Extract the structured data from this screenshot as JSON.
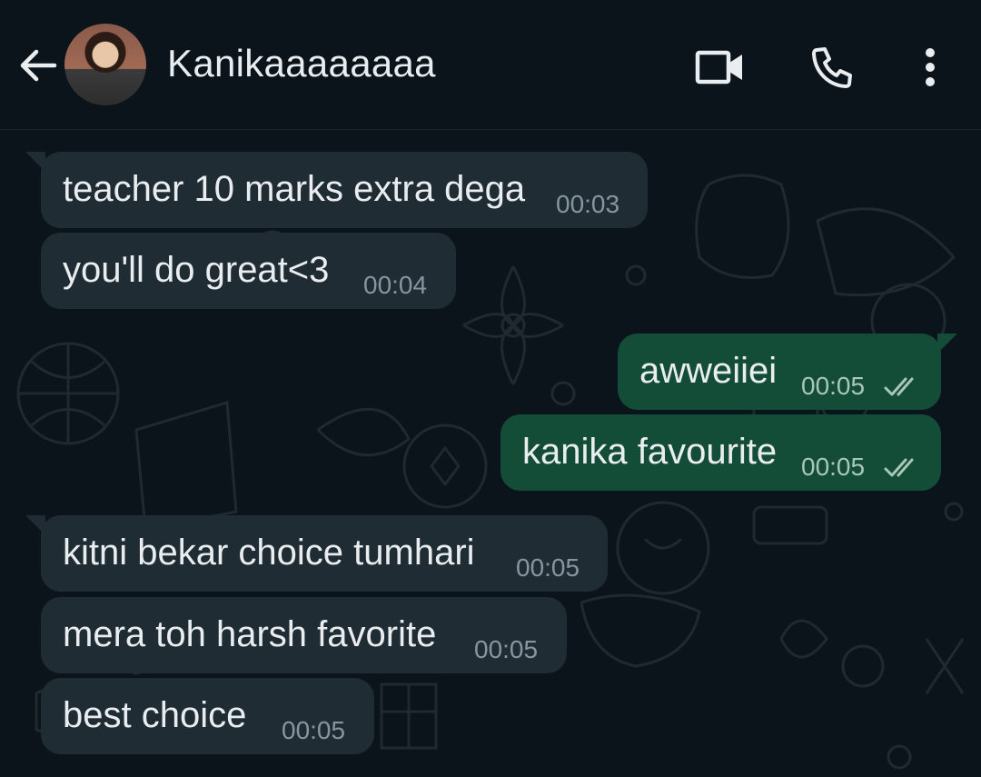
{
  "header": {
    "contact_name": "Kanikaaaaaaaa",
    "icons": [
      "back-arrow-icon",
      "video-call-icon",
      "voice-call-icon",
      "more-options-icon"
    ]
  },
  "messages": [
    {
      "direction": "incoming",
      "text": "teacher 10 marks extra dega",
      "time": "00:03"
    },
    {
      "direction": "incoming",
      "text": "you'll do great<3",
      "time": "00:04"
    },
    {
      "direction": "outgoing",
      "text": "awweiiei",
      "time": "00:05",
      "status": "read"
    },
    {
      "direction": "outgoing",
      "text": "kanika favourite",
      "time": "00:05",
      "status": "read"
    },
    {
      "direction": "incoming",
      "text": "kitni bekar choice tumhari",
      "time": "00:05"
    },
    {
      "direction": "incoming",
      "text": "mera toh harsh favorite",
      "time": "00:05"
    },
    {
      "direction": "incoming",
      "text": "best choice",
      "time": "00:05"
    }
  ],
  "colors": {
    "background": "#0b141a",
    "incoming_bubble": "#202c33",
    "outgoing_bubble": "#144d37",
    "text": "#e9edef",
    "meta": "#8696a0"
  }
}
